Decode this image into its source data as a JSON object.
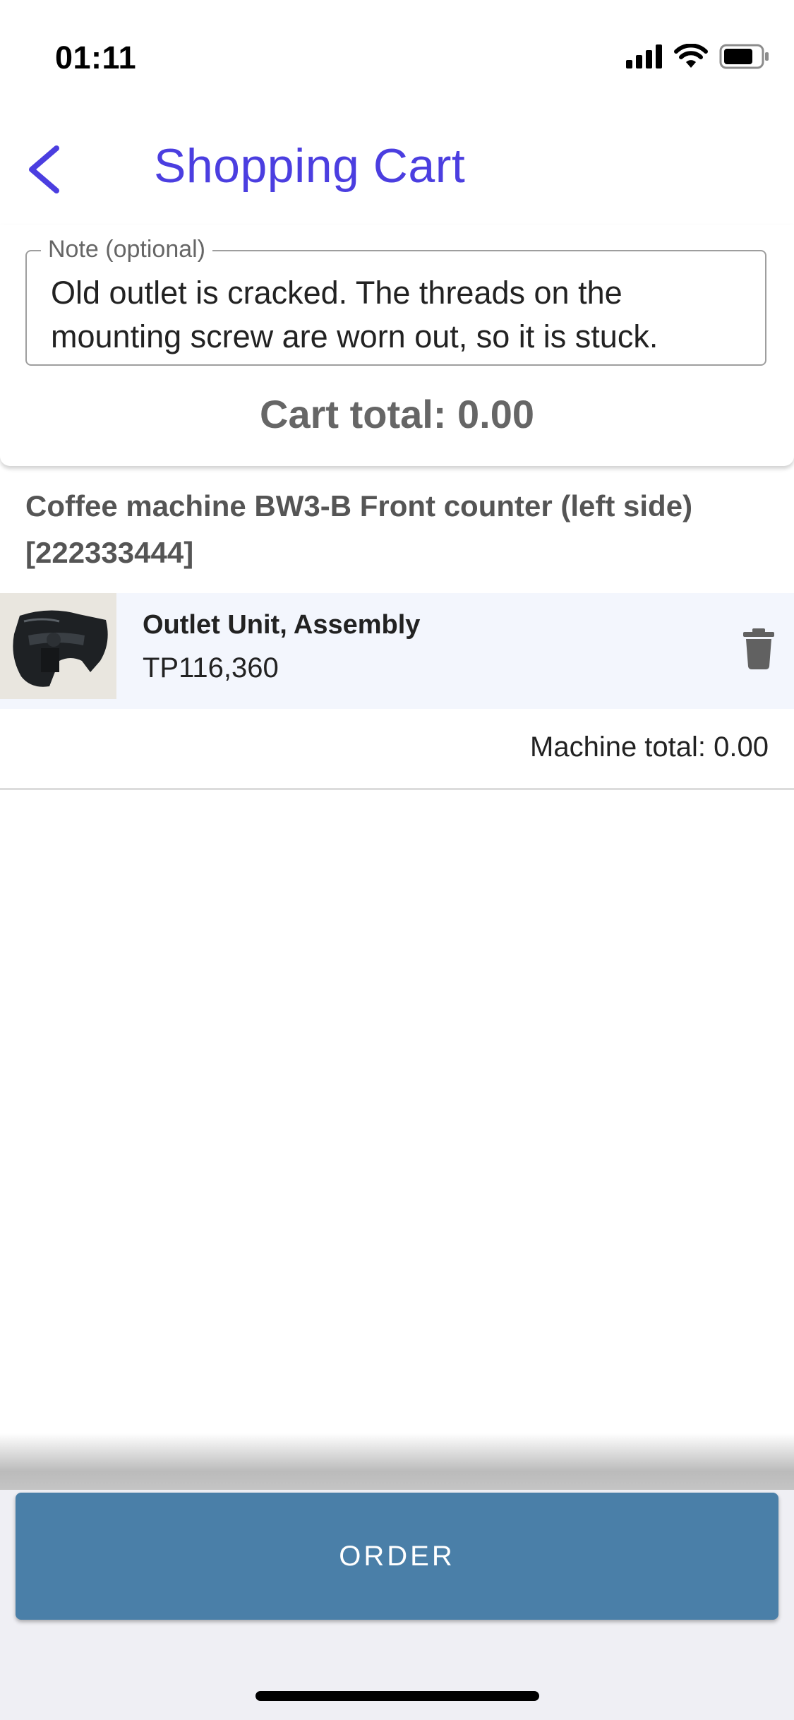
{
  "status_bar": {
    "time": "01:11",
    "icons": [
      "signal-icon",
      "wifi-icon",
      "battery-icon"
    ]
  },
  "header": {
    "back_icon": "chevron-left-icon",
    "title": "Shopping Cart",
    "accent_color": "#4b3ee0"
  },
  "note": {
    "label": "Note (optional)",
    "value": "Old outlet is cracked. The threads on the mounting screw are worn out, so it is stuck."
  },
  "cart": {
    "total_text": "Cart total: 0.00"
  },
  "machines": [
    {
      "title": "Coffee machine BW3-B Front counter (left side) [222333444]",
      "items": [
        {
          "name": "Outlet Unit, Assembly",
          "code": "TP116,360",
          "delete_icon": "trash-icon"
        }
      ],
      "total_text": "Machine total: 0.00"
    }
  ],
  "footer": {
    "order_label": "ORDER",
    "button_color": "#4a7fa8"
  }
}
